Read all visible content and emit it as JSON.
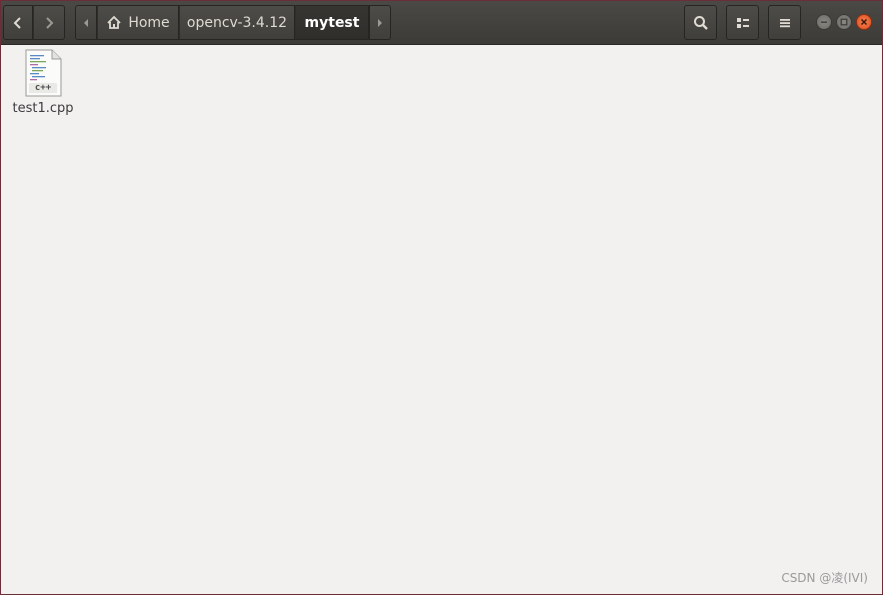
{
  "window": {
    "accent_close": "#e0521f",
    "border_color": "#6b2d38"
  },
  "toolbar": {
    "back_icon": "chevron-left-icon",
    "forward_icon": "chevron-right-icon",
    "path_scroll_left_icon": "triangle-left-icon",
    "path_scroll_right_icon": "triangle-right-icon",
    "search_icon": "search-icon",
    "view_icon": "view-options-icon",
    "menu_icon": "hamburger-menu-icon"
  },
  "breadcrumb": {
    "items": [
      {
        "label": "Home",
        "icon": "home-icon"
      },
      {
        "label": "opencv-3.4.12"
      },
      {
        "label": "mytest",
        "active": true
      }
    ]
  },
  "window_controls": {
    "minimize_icon": "minimize-icon",
    "maximize_icon": "maximize-icon",
    "close_icon": "close-icon"
  },
  "files": [
    {
      "name": "test1.cpp",
      "icon": "cpp-file-icon",
      "icon_text": "c++"
    }
  ],
  "watermark": "CSDN @凌(ⅠⅤⅠ)"
}
